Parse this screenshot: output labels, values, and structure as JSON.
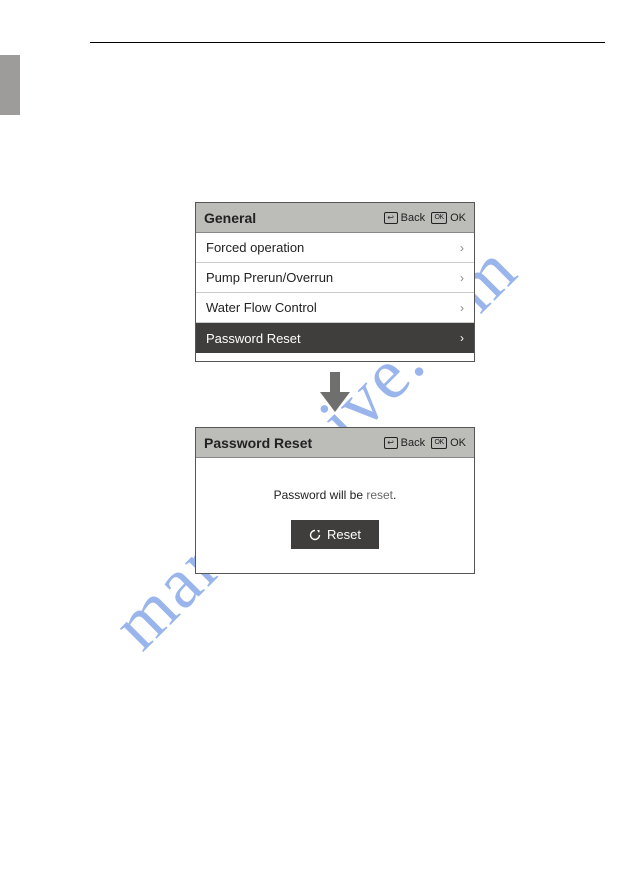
{
  "watermark": "manualshive.com",
  "screen1": {
    "title": "General",
    "back": "Back",
    "ok": "OK",
    "items": [
      {
        "label": "Forced operation"
      },
      {
        "label": "Pump Prerun/Overrun"
      },
      {
        "label": "Water Flow Control"
      },
      {
        "label": "Password Reset"
      }
    ]
  },
  "screen2": {
    "title": "Password Reset",
    "back": "Back",
    "ok": "OK",
    "body_prefix": "Password will be ",
    "body_suffix_lite": "reset",
    "body_end": ".",
    "button": "Reset"
  }
}
